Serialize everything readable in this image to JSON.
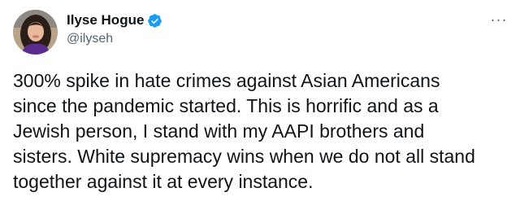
{
  "author": {
    "display_name": "Ilyse Hogue",
    "handle": "@ilyseh",
    "verified": true
  },
  "menu": {
    "more_label": "···"
  },
  "tweet": {
    "lines": [
      "300% spike in hate crimes against Asian Americans",
      "since the pandemic started. This is horrific and as a",
      "Jewish person, I stand with my AAPI brothers and",
      "sisters. White supremacy wins when we do not all stand",
      "together against it at every instance."
    ]
  },
  "colors": {
    "verified_badge": "#1d9bf0",
    "secondary_text": "#536471",
    "primary_text": "#0f1419"
  },
  "icons": {
    "avatar": "profile-photo",
    "verified": "verified-badge-icon",
    "more": "more-options-icon"
  }
}
